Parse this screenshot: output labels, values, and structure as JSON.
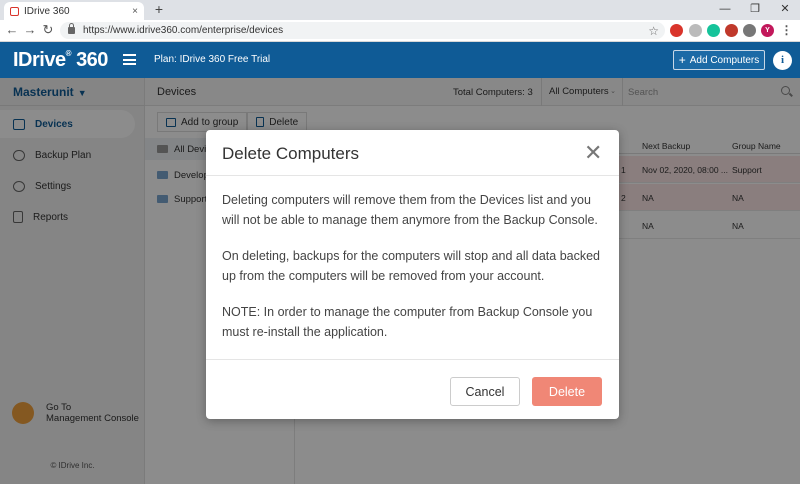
{
  "browser": {
    "tab_title": "IDrive 360",
    "tab_close": "×",
    "new_tab": "+",
    "url": "https://www.idrive360.com/enterprise/devices",
    "back": "←",
    "forward": "→",
    "reload": "↻",
    "bookmark_star": "☆",
    "minimize": "—",
    "restore": "❐",
    "close": "✕",
    "profile_letter": "Y",
    "menu": "⋮"
  },
  "header": {
    "logo": "IDrive",
    "logo_suffix": "360",
    "logo_reg": "®",
    "plan": "Plan: IDrive 360 Free Trial",
    "add_computers": "Add Computers",
    "add_plus": "+",
    "info": "i"
  },
  "sidebar": {
    "unit": "Masterunit",
    "unit_chevron": "▼",
    "items": [
      {
        "label": "Devices",
        "icon": "monitor-icon"
      },
      {
        "label": "Backup Plan",
        "icon": "cloud-icon"
      },
      {
        "label": "Settings",
        "icon": "gear-icon"
      },
      {
        "label": "Reports",
        "icon": "document-icon"
      }
    ],
    "goto_line1": "Go To",
    "goto_line2": "Management Console",
    "copyright": "© IDrive Inc."
  },
  "main": {
    "title": "Devices",
    "total": "Total Computers: 3",
    "filter": "All Computers",
    "filter_chevron": "⌄",
    "search_placeholder": "Search",
    "add_to_group": "Add to group",
    "delete": "Delete",
    "groups": [
      "All Devic",
      "Develop",
      "Support"
    ],
    "columns": {
      "next_backup": "Next Backup",
      "group_name": "Group Name"
    },
    "rows": [
      {
        "partial": "1",
        "next_backup": "Nov 02, 2020, 08:00 ...",
        "group": "Support"
      },
      {
        "partial": "2",
        "next_backup": "NA",
        "group": "NA"
      },
      {
        "partial": "",
        "next_backup": "NA",
        "group": "NA"
      }
    ]
  },
  "modal": {
    "title": "Delete Computers",
    "close": "✕",
    "paragraph1": "Deleting computers will remove them from the Devices list and you will not be able to manage them anymore from the Backup Console.",
    "paragraph2": "On deleting, backups for the computers will stop and all data backed up from the computers will be removed from your account.",
    "paragraph3": "NOTE: In order to manage the computer from Backup Console you must re-install the application.",
    "cancel": "Cancel",
    "delete": "Delete"
  },
  "colors": {
    "header_blue": "#0f5b96",
    "delete_button": "#f08776",
    "sidebar_bg": "#f2f2f2",
    "highlight_row": "#fbe6e6"
  }
}
